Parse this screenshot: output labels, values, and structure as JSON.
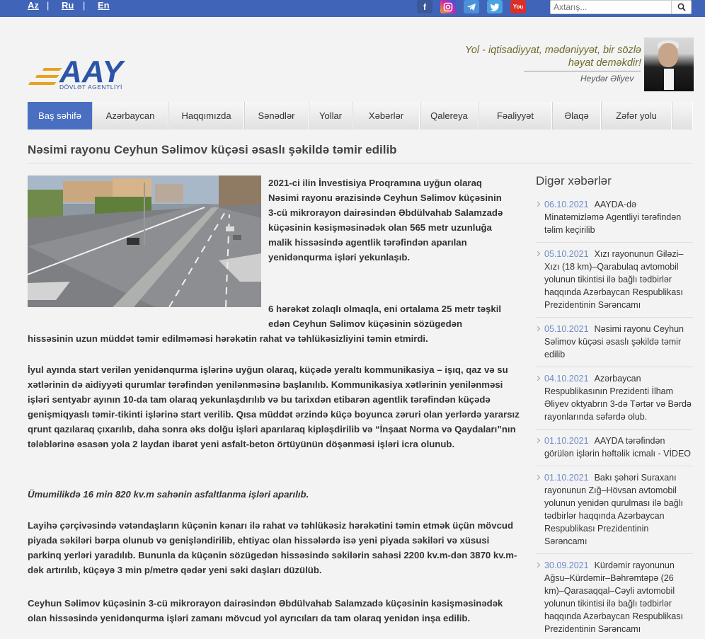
{
  "topbar": {
    "langs": [
      "Az",
      "Ru",
      "En"
    ],
    "social_icons": [
      "facebook-icon",
      "instagram-icon",
      "telegram-icon",
      "twitter-icon",
      "youtube-icon"
    ],
    "search_placeholder": "Axtarış...",
    "colors": {
      "bar": "#3f64b8"
    }
  },
  "header": {
    "logo_text": "AAY",
    "logo_sub": "DÖVLƏT AGENTLİYİ",
    "quote_line1": "Yol - iqtisadiyyat, mədəniyyət, bir sözlə",
    "quote_line2": "həyat deməkdir!",
    "quote_author": "Heydər Əliyev"
  },
  "nav": {
    "items": [
      "Baş səhifə",
      "Azərbaycan",
      "Haqqımızda",
      "Sənədlər",
      "Yollar",
      "Xəbərlər",
      "Qalereya",
      "Fəaliyyət",
      "Əlaqə",
      "Zəfər yolu"
    ],
    "active": "Baş səhifə",
    "colors": {
      "active": "#4a6fc1"
    }
  },
  "article": {
    "title": "Nəsimi rayonu Ceyhun Səlimov küçəsi əsaslı şəkildə təmir edilib",
    "p1": "2021-ci ilin İnvestisiya Proqramına uyğun olaraq Nəsimi rayonu ərazisində Ceyhun Səlimov küçəsinin 3-cü mikrorayon dairəsindən Əbdülvahab Salamzadə küçəsinin kəsişməsinədək olan 565 metr uzunluğa malik hissəsində agentlik tərəfindən aparılan yenidənqurma işləri yekunlaşıb.",
    "p2a": "6 hərəkət zolaqlı olmaqla, eni ortalama 25 metr təşkil edən Ceyhun Səlimov küçəsinin sözügedən",
    "p2b": "hissəsinin uzun müddət təmir edilməməsi hərəkətin rahat və təhlükəsizliyini təmin etmirdi.",
    "p3": "İyul ayında start verilən yenidənqurma işlərinə uyğun olaraq, küçədə yeraltı kommunikasiya – işıq, qaz və su xətlərinin də aidiyyəti qurumlar tərəfindən yenilənməsinə başlanılıb. Kommunikasiya xətlərinin yenilənməsi işləri sentyabr ayının 10-da tam olaraq yekunlaşdırılıb və bu tarixdən etibarən agentlik tərəfindən küçədə genişmiqyaslı təmir-tikinti işlərinə start verilib. Qısa müddət ərzində küçə boyunca zəruri olan yerlərdə yararsız qrunt qazılaraq çıxarılıb, daha sonra əks dolğu işləri aparılaraq kipləşdirilib və “İnşaat Norma və Qaydaları”nın tələblərinə əsasən yola 2 laydan ibarət yeni asfalt-beton örtüyünün döşənməsi işləri icra olunub.",
    "p4": "Ümumilikdə 16 min 820 kv.m sahənin asfaltlanma işləri aparılıb.",
    "p5": "Layihə çərçivəsində vətəndaşların küçənin kənarı ilə rahat və təhlükəsiz hərəkətini təmin etmək üçün mövcud piyada səkiləri bərpa olunub və genişləndirilib, ehtiyac olan hissələrdə isə yeni piyada səkiləri və xüsusi parkinq yerləri yaradılıb. Bununla da küçənin sözügedən hissəsində səkilərin sahəsi 2200 kv.m-dən 3870 kv.m-dək artırılıb, küçəyə 3 min p/metrə qədər yeni səki daşları düzülüb.",
    "p6": "Ceyhun Səlimov küçəsinin 3-cü mikrorayon dairəsindən Əbdülvahab Salamzadə küçəsinin kəsişməsinədək olan hissəsində yenidənqurma işləri zamanı mövcud yol ayrıcıları da tam olaraq yenidən inşa edilib."
  },
  "sidebar": {
    "title": "Digər xəbərlər",
    "items": [
      {
        "date": "06.10.2021",
        "text": "AAYDA-də Minatəmizləmə Agentliyi tərəfindən təlim keçirilib"
      },
      {
        "date": "05.10.2021",
        "text": "Xızı rayonunun Giləzi–Xızı (18 km)–Qarabulaq avtomobil yolunun tikintisi ilə bağlı tədbirlər haqqında Azərbaycan Respublikası Prezidentinin Sərəncamı"
      },
      {
        "date": "05.10.2021",
        "text": "Nəsimi rayonu Ceyhun Səlimov küçəsi əsaslı şəkildə təmir edilib"
      },
      {
        "date": "04.10.2021",
        "text": "Azərbaycan Respublikasının Prezidenti İlham Əliyev oktyabrın 3-də Tərtər və Bərdə rayonlarında səfərdə olub."
      },
      {
        "date": "01.10.2021",
        "text": "AAYDA tərəfindən görülən işlərin həftəlik icmalı - VİDEO"
      },
      {
        "date": "01.10.2021",
        "text": "Bakı şəhəri Suraxanı rayonunun Zığ–Hövsan avtomobil yolunun yenidən qurulması ilə bağlı tədbirlər haqqında Azərbaycan Respublikası Prezidentinin Sərəncamı"
      },
      {
        "date": "30.09.2021",
        "text": "Kürdəmir rayonunun Ağsu–Kürdəmir–Bəhrəmtəpə (26 km)–Qarasaqqal–Cəyli avtomobil yolunun tikintisi ilə bağlı tədbirlər haqqında Azərbaycan Respublikası Prezidentinin Sərəncamı"
      }
    ]
  }
}
